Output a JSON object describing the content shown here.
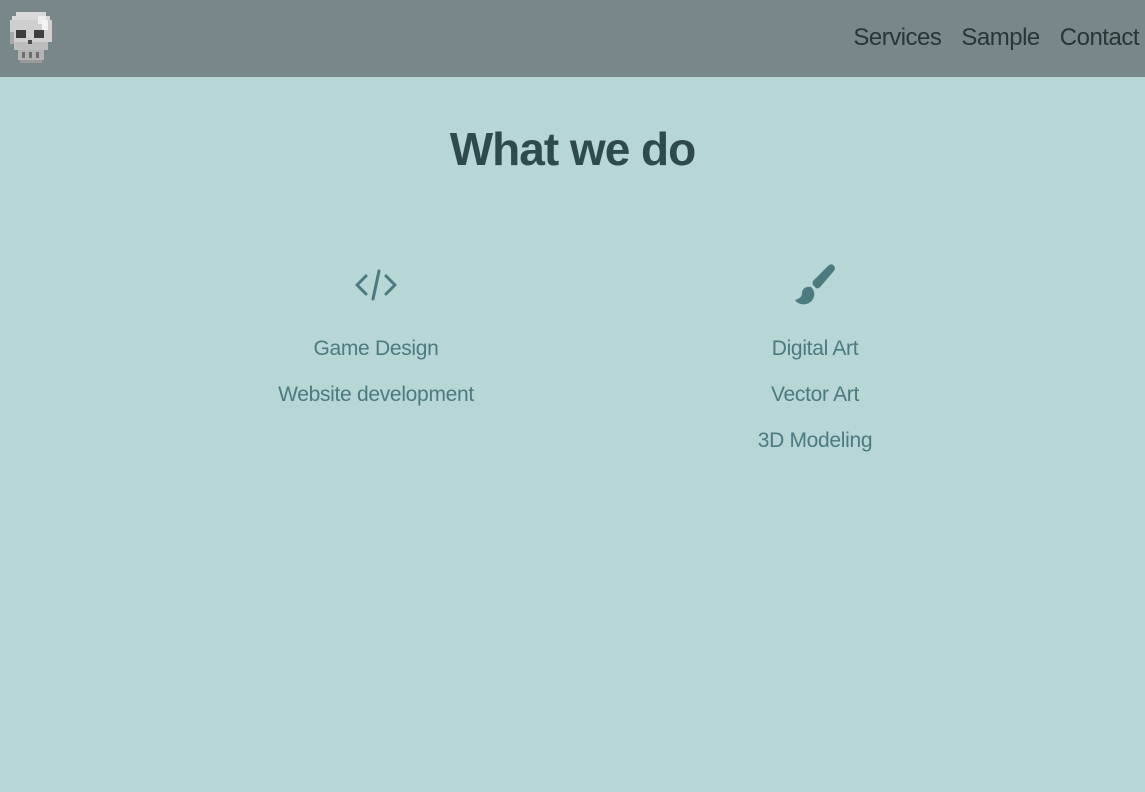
{
  "brand": {
    "logo_icon": "skull-icon"
  },
  "nav": {
    "links": [
      {
        "label": "Services"
      },
      {
        "label": "Sample"
      },
      {
        "label": "Contact"
      }
    ]
  },
  "main": {
    "title": "What we do",
    "columns": [
      {
        "icon": "code-icon",
        "items": [
          "Game Design",
          "Website development"
        ]
      },
      {
        "icon": "paintbrush-icon",
        "items": [
          "Digital Art",
          "Vector Art",
          "3D Modeling"
        ]
      }
    ]
  },
  "colors": {
    "header_bg": "#78878a",
    "page_bg": "#b7d6d6",
    "title": "#2f4a4b",
    "accent": "#4b7b7e"
  }
}
